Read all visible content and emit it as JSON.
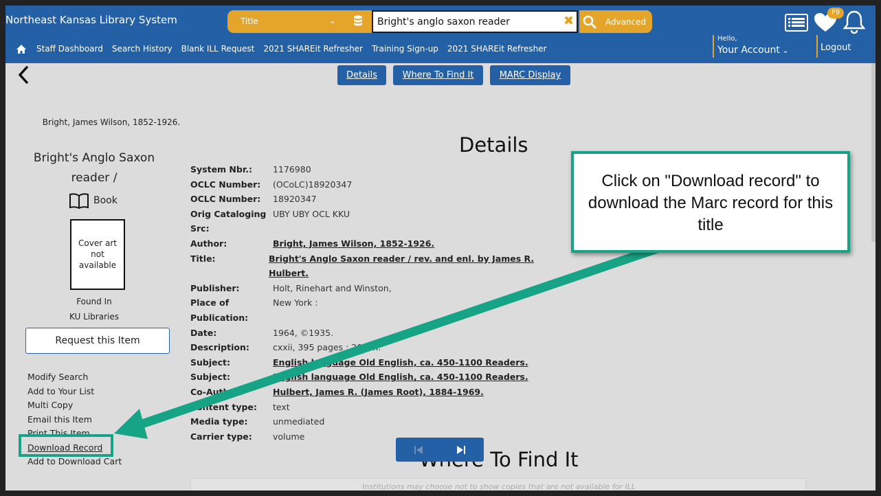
{
  "header": {
    "brand": "Northeast Kansas Library System",
    "search_type": "Title",
    "search_value": "Bright's anglo saxon reader",
    "advanced_label": "Advanced",
    "badge": "F9",
    "nav": [
      "Staff Dashboard",
      "Search History",
      "Blank ILL Request",
      "2021 SHAREit Refresher",
      "Training Sign-up",
      "2021 SHAREit Refresher"
    ],
    "hello": "Hello,",
    "account": "Your Account",
    "logout": "Logout"
  },
  "tabs": [
    "Details",
    "Where To Find It",
    "MARC Display"
  ],
  "left": {
    "author": "Bright, James Wilson, 1852-1926.",
    "title": "Bright's Anglo Saxon reader /",
    "format": "Book",
    "cover_text": "Cover art not available",
    "found_in_label": "Found In",
    "found_in_value": "KU Libraries",
    "request_label": "Request this Item",
    "actions": [
      "Modify Search",
      "Add to Your List",
      "Multi Copy",
      "Email this Item",
      "Print This Item",
      "Download Record",
      "Add to Download Cart"
    ]
  },
  "details": {
    "heading": "Details",
    "fields": [
      {
        "k": "System Nbr.:",
        "v": "1176980",
        "link": false
      },
      {
        "k": "OCLC Number:",
        "v": "(OCoLC)18920347",
        "link": false
      },
      {
        "k": "OCLC Number:",
        "v": "18920347",
        "link": false
      },
      {
        "k": "Orig Cataloging",
        "v": "UBY UBY OCL KKU",
        "link": false
      },
      {
        "k": "Src:",
        "v": "",
        "link": false
      },
      {
        "k": "Author:",
        "v": "Bright, James Wilson, 1852-1926.",
        "link": true
      },
      {
        "k": "Title:",
        "v": "Bright's Anglo Saxon reader / rev. and enl. by James R. Hulbert.",
        "link": true
      },
      {
        "k": "Publisher:",
        "v": "Holt, Rinehart and Winston,",
        "link": false
      },
      {
        "k": "Place of",
        "v": "New York :",
        "link": false
      },
      {
        "k": "Publication:",
        "v": "",
        "link": false
      },
      {
        "k": "Date:",
        "v": "1964, ©1935.",
        "link": false
      },
      {
        "k": "Description:",
        "v": "cxxii, 395 pages ; 20 cm.",
        "link": false
      },
      {
        "k": "Subject:",
        "v": "English language Old English, ca. 450-1100 Readers.",
        "link": true
      },
      {
        "k": "Subject:",
        "v": "English language Old English, ca. 450-1100 Readers.",
        "link": true
      },
      {
        "k": "Co-Author:",
        "v": "Hulbert, James R. (James Root), 1884-1969.",
        "link": true
      },
      {
        "k": "Content type:",
        "v": "text",
        "link": false
      },
      {
        "k": "Media type:",
        "v": "unmediated",
        "link": false
      },
      {
        "k": "Carrier type:",
        "v": "volume",
        "link": false
      }
    ]
  },
  "callout": "Click on \"Download record\" to download the Marc record for this title",
  "where_heading": "Where To Find It",
  "notice": "Institutions may choose not to show copies that are not available for ILL",
  "colors": {
    "header": "#2360a5",
    "accent": "#e4a52a",
    "highlight": "#17a385"
  }
}
